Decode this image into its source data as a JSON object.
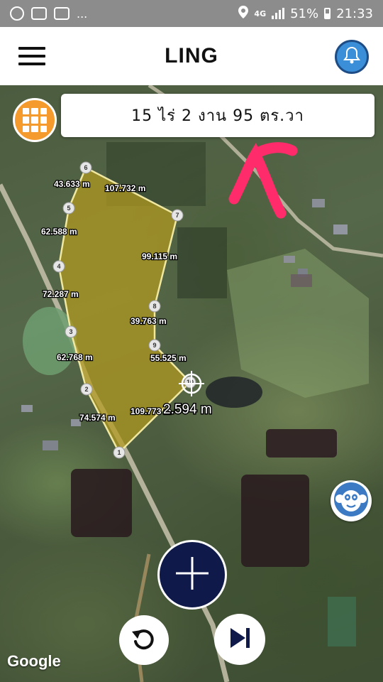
{
  "status_bar": {
    "left_icons": [
      "line-app-icon",
      "gallery-icon",
      "chat-icon"
    ],
    "overflow": "...",
    "network": "4G",
    "battery": "51%",
    "time": "21:33"
  },
  "app_bar": {
    "title": "LING",
    "menu_icon": "hamburger-icon",
    "action_icon": "bell-icon"
  },
  "area": {
    "text": "15  ไร่ 2  งาน 95  ตร.วา"
  },
  "measurements": [
    {
      "id": "m1",
      "label": "43.633 m"
    },
    {
      "id": "m2",
      "label": "107.732 m"
    },
    {
      "id": "m3",
      "label": "62.588 m"
    },
    {
      "id": "m4",
      "label": "99.115 m"
    },
    {
      "id": "m5",
      "label": "72.287 m"
    },
    {
      "id": "m6",
      "label": "39.763 m"
    },
    {
      "id": "m7",
      "label": "55.525 m"
    },
    {
      "id": "m8",
      "label": "62.768 m"
    },
    {
      "id": "m9",
      "label": "109.773 m"
    },
    {
      "id": "m10",
      "label": "74.574 m"
    }
  ],
  "current_segment": "2.594 m",
  "vertices": [
    "1",
    "2",
    "3",
    "4",
    "5",
    "6",
    "7",
    "8",
    "9",
    "10"
  ],
  "map_attribution": "Google",
  "colors": {
    "polygon_fill": "#b39a1e",
    "polygon_stroke": "#f0e8a0",
    "annotation": "#ff2b6a",
    "grid_button": "#f59a2c",
    "add_button": "#0f1a4a",
    "bell_button": "#3b8fd8"
  }
}
